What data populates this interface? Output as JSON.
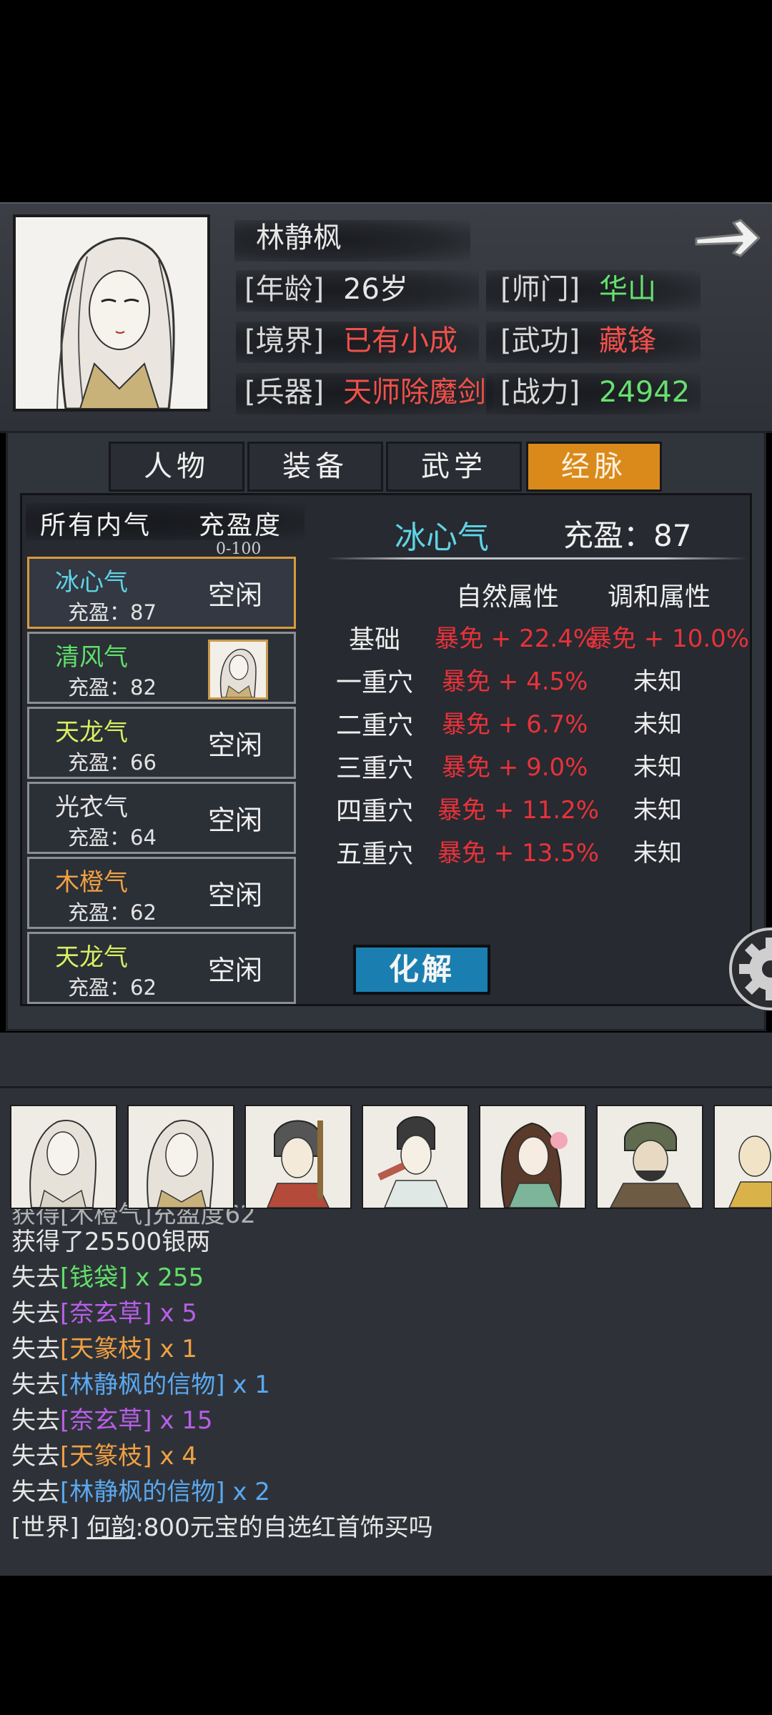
{
  "character": {
    "name": "林静枫",
    "fields": [
      {
        "label": "[年龄]",
        "value": "26岁"
      },
      {
        "label": "[师门]",
        "value": "华山"
      },
      {
        "label": "[境界]",
        "value": "已有小成"
      },
      {
        "label": "[武功]",
        "value": "藏锋"
      },
      {
        "label": "[兵器]",
        "value": "天师除魔剑"
      },
      {
        "label": "[战力]",
        "value": "24942"
      }
    ]
  },
  "tabs": [
    {
      "label": "人物",
      "active": false
    },
    {
      "label": "装备",
      "active": false
    },
    {
      "label": "武学",
      "active": false
    },
    {
      "label": "经脉",
      "active": true
    }
  ],
  "qi_list": {
    "header_all": "所有内气",
    "header_fill": "充盈度",
    "range_note": "0-100",
    "items": [
      {
        "name": "冰心气",
        "fill": "充盈：87",
        "status": "空闲",
        "name_color": "#5fd3e6",
        "selected": true
      },
      {
        "name": "清风气",
        "fill": "充盈：82",
        "status": "",
        "name_color": "#5fe06a",
        "selected": false
      },
      {
        "name": "天龙气",
        "fill": "充盈：66",
        "status": "空闲",
        "name_color": "#d8f060",
        "selected": false
      },
      {
        "name": "光衣气",
        "fill": "充盈：64",
        "status": "空闲",
        "name_color": "#e6e6e6",
        "selected": false
      },
      {
        "name": "木橙气",
        "fill": "充盈：62",
        "status": "空闲",
        "name_color": "#f0a044",
        "selected": false
      },
      {
        "name": "天龙气",
        "fill": "充盈：62",
        "status": "空闲",
        "name_color": "#d8f060",
        "selected": false
      }
    ]
  },
  "detail": {
    "title": "冰心气",
    "fill_label": "充盈：87",
    "col_natural": "自然属性",
    "col_harmony": "调和属性",
    "rows": [
      {
        "label": "基础",
        "natural": "暴免 + 22.4%",
        "harmony": "暴免 + 10.0%"
      },
      {
        "label": "一重穴",
        "natural": "暴免 + 4.5%",
        "harmony": "未知"
      },
      {
        "label": "二重穴",
        "natural": "暴免 + 6.7%",
        "harmony": "未知"
      },
      {
        "label": "三重穴",
        "natural": "暴免 + 9.0%",
        "harmony": "未知"
      },
      {
        "label": "四重穴",
        "natural": "暴免 + 11.2%",
        "harmony": "未知"
      },
      {
        "label": "五重穴",
        "natural": "暴免 + 13.5%",
        "harmony": "未知"
      }
    ],
    "dissolve_label": "化解"
  },
  "log": {
    "partial_line": "获得[木橙气]充盈度62",
    "lines": [
      {
        "prefix": "获得了25500银两",
        "item": "",
        "suffix": "",
        "color": "white"
      },
      {
        "prefix": "失去",
        "item": "[钱袋]",
        "suffix": " x 255",
        "color": "green"
      },
      {
        "prefix": "失去",
        "item": "[奈玄草]",
        "suffix": " x 5",
        "color": "purple"
      },
      {
        "prefix": "失去",
        "item": "[天篆枝]",
        "suffix": " x 1",
        "color": "orange"
      },
      {
        "prefix": "失去",
        "item": "[林静枫的信物]",
        "suffix": " x 1",
        "color": "blue"
      },
      {
        "prefix": "失去",
        "item": "[奈玄草]",
        "suffix": " x 15",
        "color": "purple"
      },
      {
        "prefix": "失去",
        "item": "[天篆枝]",
        "suffix": " x 4",
        "color": "orange"
      },
      {
        "prefix": "失去",
        "item": "[林静枫的信物]",
        "suffix": " x 2",
        "color": "blue"
      }
    ],
    "world": {
      "channel": "[世界]",
      "speaker": "何韵",
      "message": ":800元宝的自选红首饰买吗"
    }
  },
  "icons": {
    "next": "arrow-right-icon",
    "settings": "gear-icon"
  }
}
